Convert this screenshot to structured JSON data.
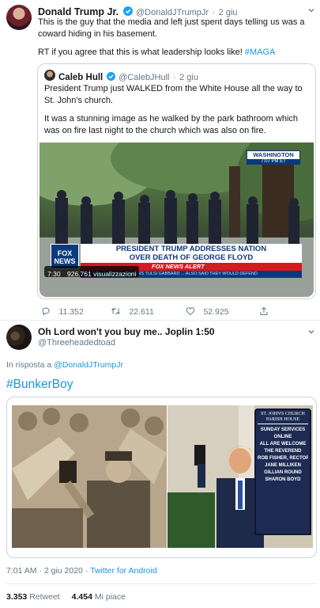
{
  "tweet": {
    "author_name": "Donald Trump Jr.",
    "handle": "@DonaldJTrumpJr",
    "dot": "·",
    "date": "2 giu",
    "text_1": "This is the guy that the media and left just spent days telling us was a coward hiding in his basement.",
    "text_2_prefix": "RT if you agree that this is what leadership looks like!",
    "hashtag": "#MAGA",
    "quoted": {
      "author_name": "Caleb Hull",
      "handle": "@CalebJHull",
      "date": "2 giu",
      "text_1": "President Trump just WALKED from the White House all the way to St. John's church.",
      "text_2": "It was a stunning image as he walked by the park bathroom which was on fire last night to the church which was also on fire.",
      "video": {
        "location_badge": "WASHINGTON",
        "time_badge": "7:07 PM ET",
        "headline_line1": "PRESIDENT TRUMP ADDRESSES NATION",
        "headline_line2": "OVER DEATH OF GEORGE FLOYD",
        "network": "FOX NEWS",
        "alert": "FOX NEWS ALERT",
        "ticker": "TWO LEADERS TULSI GABBARD ... ALSO SAID THEY WOULD DEFEND",
        "duration": "7:30",
        "views": "926.761 visualizzazioni"
      }
    },
    "replies": "11.352",
    "retweets": "22.611",
    "likes": "52.925"
  },
  "reply": {
    "author_name": "Oh Lord won't you buy me.. Joplin 1:50",
    "handle": "@Threeheadedtoad",
    "in_reply_prefix": "In risposta a",
    "in_reply_handle": "@DonaldJTrumpJr",
    "hashtag": "#BunkerBoy",
    "sign_text": "ST. JOHN'S CHURCH PARISH HOUSE",
    "sign_lines": [
      "SUNDAY SERVICES",
      "ONLINE",
      "ALL ARE WELCOME",
      "THE REVEREND",
      "ROB FISHER, RECTOR",
      "JANE MILLIKEN",
      "GILLIAN ROUND",
      "SHARON BOYD"
    ],
    "timestamp": "7:01 AM · 2 giu 2020 ·",
    "client": "Twitter for Android",
    "retweet_count": "3.353",
    "retweet_label": "Retweet",
    "like_count": "4.454",
    "like_label": "Mi piace"
  },
  "colors": {
    "accent": "#1b95e0",
    "muted": "#657786",
    "border": "#ccd6dd",
    "fox_red": "#d71920",
    "fox_blue": "#0a3a7a"
  }
}
